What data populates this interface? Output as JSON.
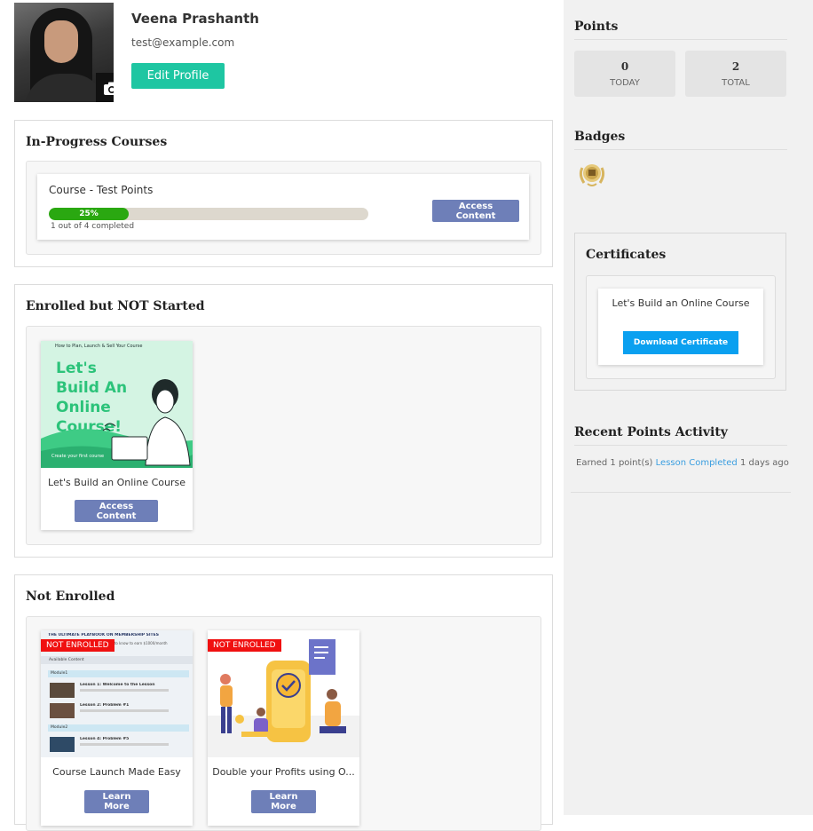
{
  "profile": {
    "name": "Veena Prashanth",
    "email": "test@example.com",
    "edit_label": "Edit Profile"
  },
  "in_progress": {
    "title": "In-Progress Courses",
    "course": {
      "title": "Course - Test Points",
      "progress_percent": 25,
      "progress_label": "25%",
      "progress_text": "1 out of 4 completed",
      "button_label": "Access Content"
    }
  },
  "enrolled": {
    "title": "Enrolled but NOT Started",
    "course": {
      "title": "Let's Build an Online Course",
      "thumb_heading": "Let's Build An Online Course!",
      "thumb_top_text": "How to Plan, Launch & Sell Your Course",
      "thumb_bottom_text": "Create your first course",
      "button_label": "Access Content"
    }
  },
  "not_enrolled": {
    "title": "Not Enrolled",
    "badge_label": "NOT ENROLLED",
    "courses": [
      {
        "title": "Course Launch Made Easy",
        "button_label": "Learn More",
        "thumb_header": "THE ULTIMATE PLAYBOOK ON MEMBERSHIP SITES",
        "thumb_sub": "Everything you need to know to earn $1000/month",
        "available": "Available Content",
        "module1": "Module1",
        "lessons1": [
          "Lesson 1: Welcome to the Lesson",
          "Lesson 2: Problem #1"
        ],
        "module2": "Module2",
        "lessons2": [
          "Lesson 4: Problem #5"
        ]
      },
      {
        "title": "Double your Profits using O...",
        "button_label": "Learn More"
      }
    ]
  },
  "sidebar": {
    "points_title": "Points",
    "today_value": "0",
    "today_label": "TODAY",
    "total_value": "2",
    "total_label": "TOTAL",
    "badges_title": "Badges",
    "certificates_title": "Certificates",
    "certificate": {
      "title": "Let's Build an Online Course",
      "button_label": "Download Certificate"
    },
    "activity_title": "Recent Points Activity",
    "activity": {
      "prefix": "Earned 1 point(s) ",
      "link": "Lesson Completed",
      "suffix": " 1 days ago"
    }
  },
  "colors": {
    "accent_green": "#1ec6a2",
    "button_purple": "#6e7fb8",
    "progress_green": "#2aa811",
    "badge_red": "#f01010",
    "download_blue": "#0aa0f0"
  },
  "icons": {
    "camera": "camera-icon",
    "badge": "laurel-badge-icon"
  }
}
